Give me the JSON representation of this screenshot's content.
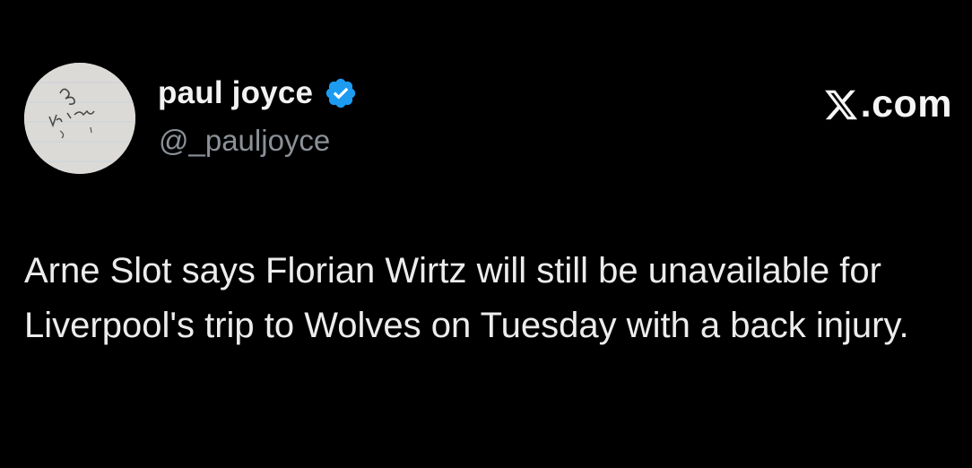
{
  "author": {
    "display_name": "paul joyce",
    "handle": "@_pauljoyce",
    "verified": true,
    "avatar_icon": "handwritten-note-avatar"
  },
  "brand": {
    "label": ".com",
    "logo_icon": "x-logo-icon"
  },
  "tweet": {
    "text": "Arne Slot says Florian Wirtz will still be unavailable for Liverpool's trip to Wolves on Tuesday with a back injury."
  },
  "colors": {
    "background": "#000000",
    "verified_badge": "#1d9bf0",
    "handle": "#8b9197",
    "text": "#ececec"
  }
}
